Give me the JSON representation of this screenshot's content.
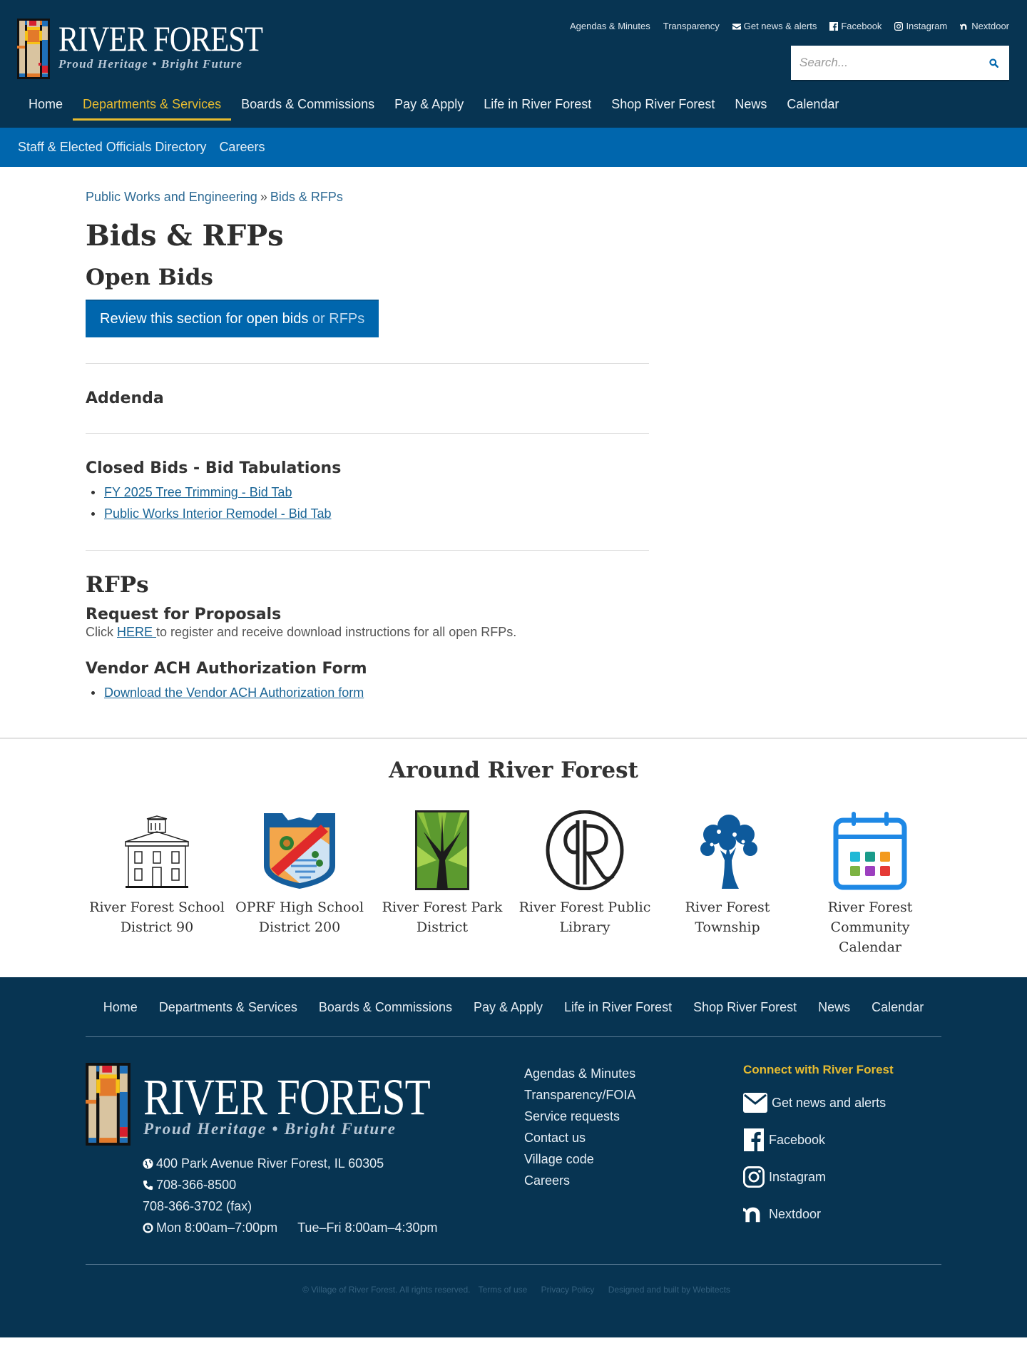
{
  "header": {
    "logo_title": "RIVER FOREST",
    "logo_tagline": "Proud Heritage • Bright Future",
    "utility_links": [
      {
        "label": "Agendas & Minutes",
        "icon": ""
      },
      {
        "label": "Transparency",
        "icon": ""
      },
      {
        "label": "Get news & alerts",
        "icon": "envelope-icon"
      },
      {
        "label": "Facebook",
        "icon": "facebook-icon"
      },
      {
        "label": "Instagram",
        "icon": "instagram-icon"
      },
      {
        "label": "Nextdoor",
        "icon": "nextdoor-icon"
      }
    ],
    "search_placeholder": "Search...",
    "search_icon": "search-icon"
  },
  "nav": {
    "items": [
      "Home",
      "Departments & Services",
      "Boards & Commissions",
      "Pay & Apply",
      "Life in River Forest",
      "Shop River Forest",
      "News",
      "Calendar"
    ],
    "active": "Departments & Services"
  },
  "subnav": {
    "items": [
      "Staff & Elected Officials Directory",
      "Careers"
    ]
  },
  "colors": {
    "navy": "#073452",
    "blue": "#0066ad",
    "gold": "#e7bb30",
    "link": "#1a6596"
  },
  "content": {
    "breadcrumb": {
      "parent": "Public Works and Engineering",
      "separator": "»",
      "current": "Bids & RFPs"
    },
    "title": "Bids & RFPs",
    "open_bids": {
      "heading": "Open Bids",
      "button_main": "Review this section for open bids",
      "button_tail": " or RFPs"
    },
    "addenda": {
      "heading": "Addenda"
    },
    "closed_bids": {
      "heading": "Closed Bids - Bid Tabulations",
      "links": [
        "FY 2025 Tree Trimming - Bid Tab",
        "Public Works Interior Remodel - Bid Tab"
      ]
    },
    "rfps": {
      "heading": "RFPs",
      "subheading": "Request for Proposals",
      "text_before": "Click ",
      "link_label": "HERE ",
      "text_after": "to register and receive download instructions for all open RFPs."
    },
    "vendor": {
      "heading": "Vendor ACH Authorization Form",
      "links": [
        "Download the Vendor ACH Authorization form"
      ]
    }
  },
  "around": {
    "heading": "Around River Forest",
    "items": [
      {
        "label": "River Forest School District 90",
        "icon": "schoolhouse-icon"
      },
      {
        "label": "OPRF High School District 200",
        "icon": "crest-icon"
      },
      {
        "label": "River Forest Park District",
        "icon": "tree-window-icon"
      },
      {
        "label": "River Forest Public Library",
        "icon": "library-monogram-icon"
      },
      {
        "label": "River Forest Township",
        "icon": "blue-tree-icon"
      },
      {
        "label": "River Forest Community Calendar",
        "icon": "calendar-icon"
      }
    ]
  },
  "footer": {
    "nav": [
      "Home",
      "Departments & Services",
      "Boards & Commissions",
      "Pay & Apply",
      "Life in River Forest",
      "Shop River Forest",
      "News",
      "Calendar"
    ],
    "address": "400 Park Avenue River Forest, IL 60305",
    "phone": "708-366-8500",
    "fax": "708-366-3702 (fax)",
    "hours_mon": "Mon 8:00am–7:00pm",
    "hours_tf": "Tue–Fri 8:00am–4:30pm",
    "quick_links": [
      "Agendas & Minutes",
      "Transparency/FOIA",
      "Service requests",
      "Contact us",
      "Village code",
      "Careers"
    ],
    "connect_title": "Connect with River Forest",
    "social": [
      {
        "label": "Get news and alerts",
        "icon": "envelope-icon"
      },
      {
        "label": "Facebook",
        "icon": "facebook-icon"
      },
      {
        "label": "Instagram",
        "icon": "instagram-icon"
      },
      {
        "label": "Nextdoor",
        "icon": "nextdoor-icon"
      }
    ],
    "copyright": "© Village of River Forest. All rights reserved.",
    "legal_links": [
      "Terms of use",
      "Privacy Policy",
      "Designed and built by Webitects"
    ]
  }
}
